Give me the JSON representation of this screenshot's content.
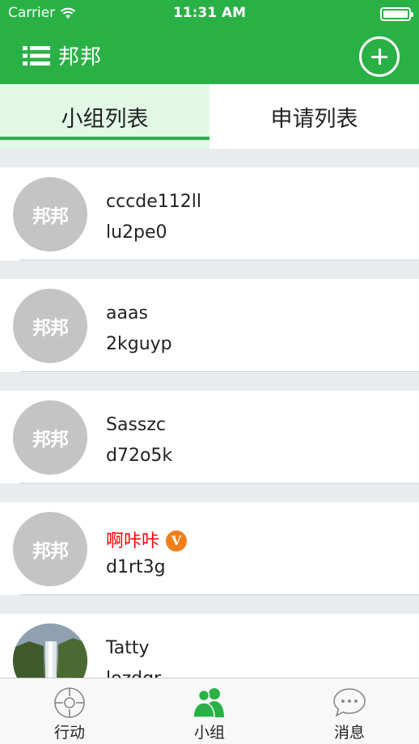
{
  "status_bar": {
    "carrier": "Carrier",
    "time": "11:31 AM"
  },
  "nav": {
    "title": "邦邦",
    "menu_icon": "list-icon",
    "add_icon": "plus-circle-icon"
  },
  "tabs": [
    {
      "label": "小组列表",
      "active": true
    },
    {
      "label": "申请列表",
      "active": false
    }
  ],
  "groups": [
    {
      "name": "cccde112ll",
      "sub": "lu2pe0",
      "avatar_text": "邦邦",
      "highlight": false
    },
    {
      "name": "aaas",
      "sub": "2kguyp",
      "avatar_text": "邦邦",
      "highlight": false
    },
    {
      "name": "Sasszc",
      "sub": "d72o5k",
      "avatar_text": "邦邦",
      "highlight": false
    },
    {
      "name": "啊咔咔",
      "sub": "d1rt3g",
      "avatar_text": "邦邦",
      "highlight": true,
      "badge": "V"
    },
    {
      "name": "Tatty",
      "sub": "lozdqr",
      "avatar_image": "waterfall-photo"
    }
  ],
  "tabbar": [
    {
      "label": "行动",
      "icon": "compass-icon",
      "active": false
    },
    {
      "label": "小组",
      "icon": "group-icon",
      "active": true
    },
    {
      "label": "消息",
      "icon": "chat-bubble-icon",
      "active": false
    }
  ],
  "colors": {
    "primary": "#2ab146",
    "highlight_name": "#ff0000",
    "vip_badge": "#f07f1a"
  }
}
